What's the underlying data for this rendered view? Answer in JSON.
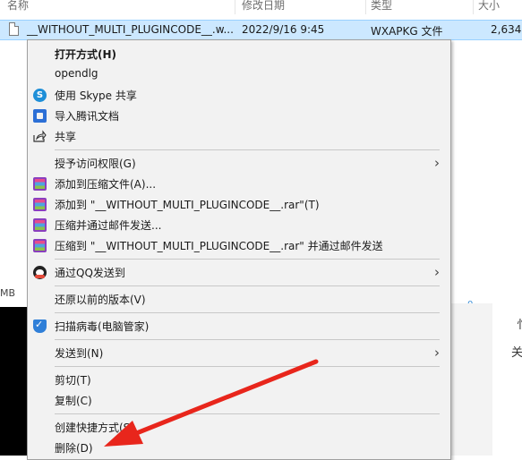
{
  "explorer": {
    "columns": {
      "name": "名称",
      "modified": "修改日期",
      "type": "类型",
      "size": "大小"
    },
    "selected_file": {
      "name": "__WITHOUT_MULTI_PLUGINCODE__.w...",
      "modified": "2022/9/16 9:45",
      "type": "WXAPKG 文件",
      "size": "2,634"
    },
    "left_size_label": "MB",
    "right_panel_text_1": "忄",
    "right_panel_text_2": "关",
    "blue_mark": "0"
  },
  "menu": {
    "open_with": "打开方式(H)",
    "opendlg": "opendlg",
    "skype_share": "使用 Skype 共享",
    "import_tencent_docs": "导入腾讯文档",
    "share": "共享",
    "grant_access": "授予访问权限(G)",
    "add_to_archive": "添加到压缩文件(A)...",
    "add_to_rar": "添加到 \"__WITHOUT_MULTI_PLUGINCODE__.rar\"(T)",
    "compress_email": "压缩并通过邮件发送...",
    "compress_rar_email": "压缩到 \"__WITHOUT_MULTI_PLUGINCODE__.rar\" 并通过邮件发送",
    "send_via_qq": "通过QQ发送到",
    "restore_previous": "还原以前的版本(V)",
    "scan_virus": "扫描病毒(电脑管家)",
    "send_to": "发送到(N)",
    "cut": "剪切(T)",
    "copy": "复制(C)",
    "create_shortcut": "创建快捷方式(S)",
    "delete": "删除(D)"
  },
  "icons": {
    "skype": "skype-icon",
    "tencent_docs": "tencent-docs-icon",
    "share": "share-icon",
    "rar": "winrar-icon",
    "qq": "qq-icon",
    "shield": "pc-manager-shield-icon",
    "chevron": "chevron-right-icon"
  },
  "colors": {
    "selection": "#cce8ff",
    "menu_bg": "#f2f2f2",
    "annotation_arrow": "#e8261c"
  }
}
